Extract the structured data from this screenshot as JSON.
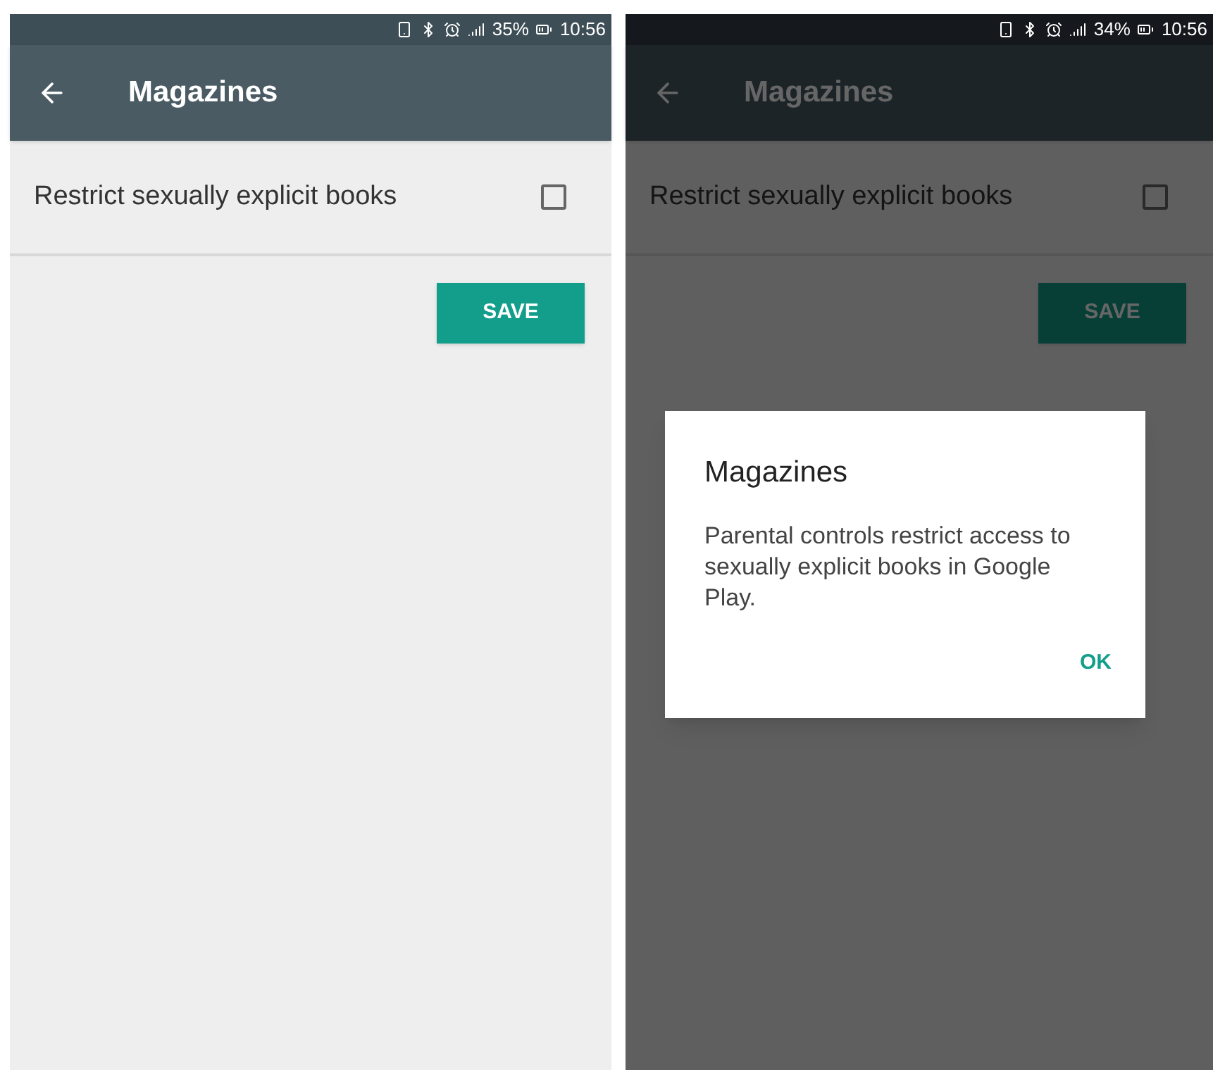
{
  "screens": [
    {
      "dimmed": false,
      "status_bar": {
        "battery": "35%",
        "time": "10:56"
      },
      "toolbar": {
        "title": "Magazines"
      },
      "setting": {
        "label": "Restrict sexually explicit books",
        "checked": false
      },
      "save_button": "SAVE"
    },
    {
      "dimmed": true,
      "status_bar": {
        "battery": "34%",
        "time": "10:56"
      },
      "toolbar": {
        "title": "Magazines"
      },
      "setting": {
        "label": "Restrict sexually explicit books",
        "checked": false
      },
      "save_button": "SAVE",
      "dialog": {
        "title": "Magazines",
        "message": "Parental controls restrict access to sexually explicit books in Google Play.",
        "button": "OK"
      }
    }
  ]
}
